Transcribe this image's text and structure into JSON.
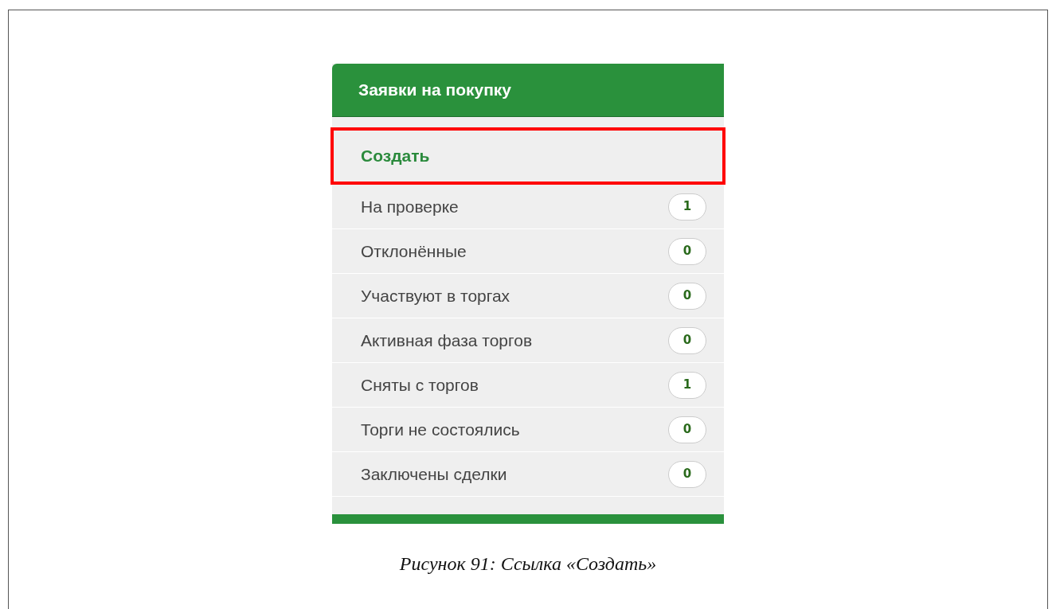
{
  "panel": {
    "title": "Заявки на покупку",
    "items": [
      {
        "kind": "action",
        "label": "Создать",
        "highlighted": true
      },
      {
        "kind": "status",
        "label": "На проверке",
        "count": "1",
        "highlighted": false
      },
      {
        "kind": "status",
        "label": "Отклонённые",
        "count": "0",
        "highlighted": false
      },
      {
        "kind": "status",
        "label": "Участвуют в торгах",
        "count": "0",
        "highlighted": false
      },
      {
        "kind": "status",
        "label": "Активная фаза торгов",
        "count": "0",
        "highlighted": false
      },
      {
        "kind": "status",
        "label": "Сняты с торгов",
        "count": "1",
        "highlighted": false
      },
      {
        "kind": "status",
        "label": "Торги не состоялись",
        "count": "0",
        "highlighted": false
      },
      {
        "kind": "status",
        "label": "Заключены сделки",
        "count": "0",
        "highlighted": false
      }
    ]
  },
  "caption": "Рисунок 91: Ссылка «Создать»"
}
